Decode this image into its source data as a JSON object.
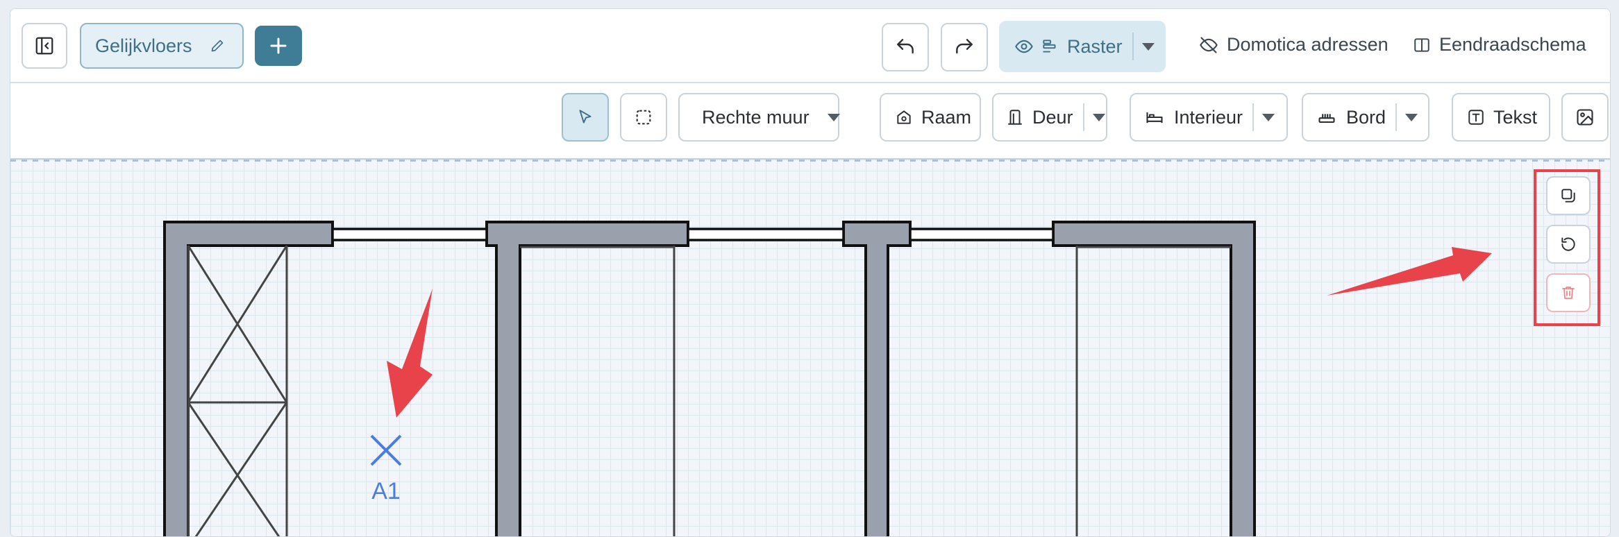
{
  "floor_tab": {
    "label": "Gelijkvloers"
  },
  "header": {
    "raster_label": "Raster",
    "domotica_label": "Domotica adressen",
    "eendraad_label": "Eendraadschema"
  },
  "toolbar": {
    "wall_label": "Rechte muur",
    "window_label": "Raam",
    "door_label": "Deur",
    "interior_label": "Interieur",
    "board_label": "Bord",
    "text_label": "Tekst"
  },
  "canvas": {
    "marker_label": "A1"
  },
  "colors": {
    "primary_dark": "#3f7d96",
    "tab_bg": "#e4f0f6",
    "raster_bg": "#d8e9f2",
    "wall_fill": "#9aa1ac",
    "marker_blue": "#4b7de0",
    "annotation_red": "#e8434a"
  },
  "icons": {
    "sidebar_toggle": "panel-left-collapse-icon",
    "edit": "pencil-icon",
    "add": "plus-icon",
    "undo": "undo-icon",
    "redo": "redo-icon",
    "eye": "eye-icon",
    "raster": "align-left-icon",
    "domotica": "eye-off-icon",
    "eendraad": "columns-icon",
    "select": "cursor-pointer-icon",
    "marquee": "dashed-square-icon",
    "wall": "dots-grid-icon",
    "window": "house-icon",
    "door": "door-icon",
    "interior": "bed-icon",
    "board": "panel-board-icon",
    "text": "text-box-icon",
    "image": "image-icon",
    "copy": "copy-icon",
    "rotate": "rotate-ccw-icon",
    "delete": "trash-icon"
  }
}
